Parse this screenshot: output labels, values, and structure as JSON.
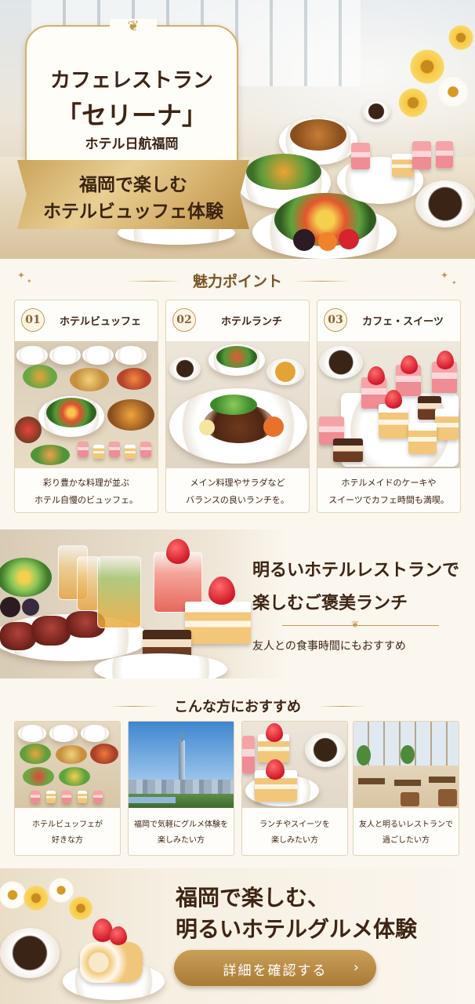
{
  "hero": {
    "restaurant_line1": "カフェレストラン",
    "restaurant_line2": "「セリーナ」",
    "hotel_name": "ホテル日航福岡",
    "banner_line1": "福岡で楽しむ",
    "banner_line2": "ホテルビュッフェ体験"
  },
  "appeal": {
    "title": "魅力ポイント",
    "cards": [
      {
        "number": "01",
        "title": "ホテルビュッフェ",
        "desc_line1": "彩り豊かな料理が並ぶ",
        "desc_line2": "ホテル自慢のビュッフェ。",
        "image": "buffet-photo"
      },
      {
        "number": "02",
        "title": "ホテルランチ",
        "desc_line1": "メイン料理やサラダなど",
        "desc_line2": "バランスの良いランチを。",
        "image": "lunch-plate-photo"
      },
      {
        "number": "03",
        "title": "カフェ・スイーツ",
        "desc_line1": "ホテルメイドのケーキや",
        "desc_line2": "スイーツでカフェ時間も満喫。",
        "image": "cake-photo"
      }
    ]
  },
  "lunch": {
    "line1": "明るいホテルレストランで",
    "line2": "楽しむご褒美ランチ",
    "subline": "友人との食事時間にもおすすめ"
  },
  "recommend": {
    "title": "こんな方におすすめ",
    "cards": [
      {
        "line1": "ホテルビュッフェが",
        "line2": "好きな方",
        "image": "buffet-photo"
      },
      {
        "line1": "福岡で気軽にグルメ体験を",
        "line2": "楽しみたい方",
        "image": "fukuoka-tower-photo"
      },
      {
        "line1": "ランチやスイーツを",
        "line2": "楽しみたい方",
        "image": "cake-coffee-photo"
      },
      {
        "line1": "友人と明るいレストランで",
        "line2": "過ごしたい方",
        "image": "restaurant-interior-photo"
      }
    ]
  },
  "cta": {
    "line1": "福岡で楽しむ、",
    "line2": "明るいホテルグルメ体験",
    "button_label": "詳細を確認する",
    "button_icon": "chevron-right-icon"
  },
  "colors": {
    "gold": "#c29a55",
    "dark_brown": "#3d2414",
    "cream": "#fbf7ef"
  }
}
